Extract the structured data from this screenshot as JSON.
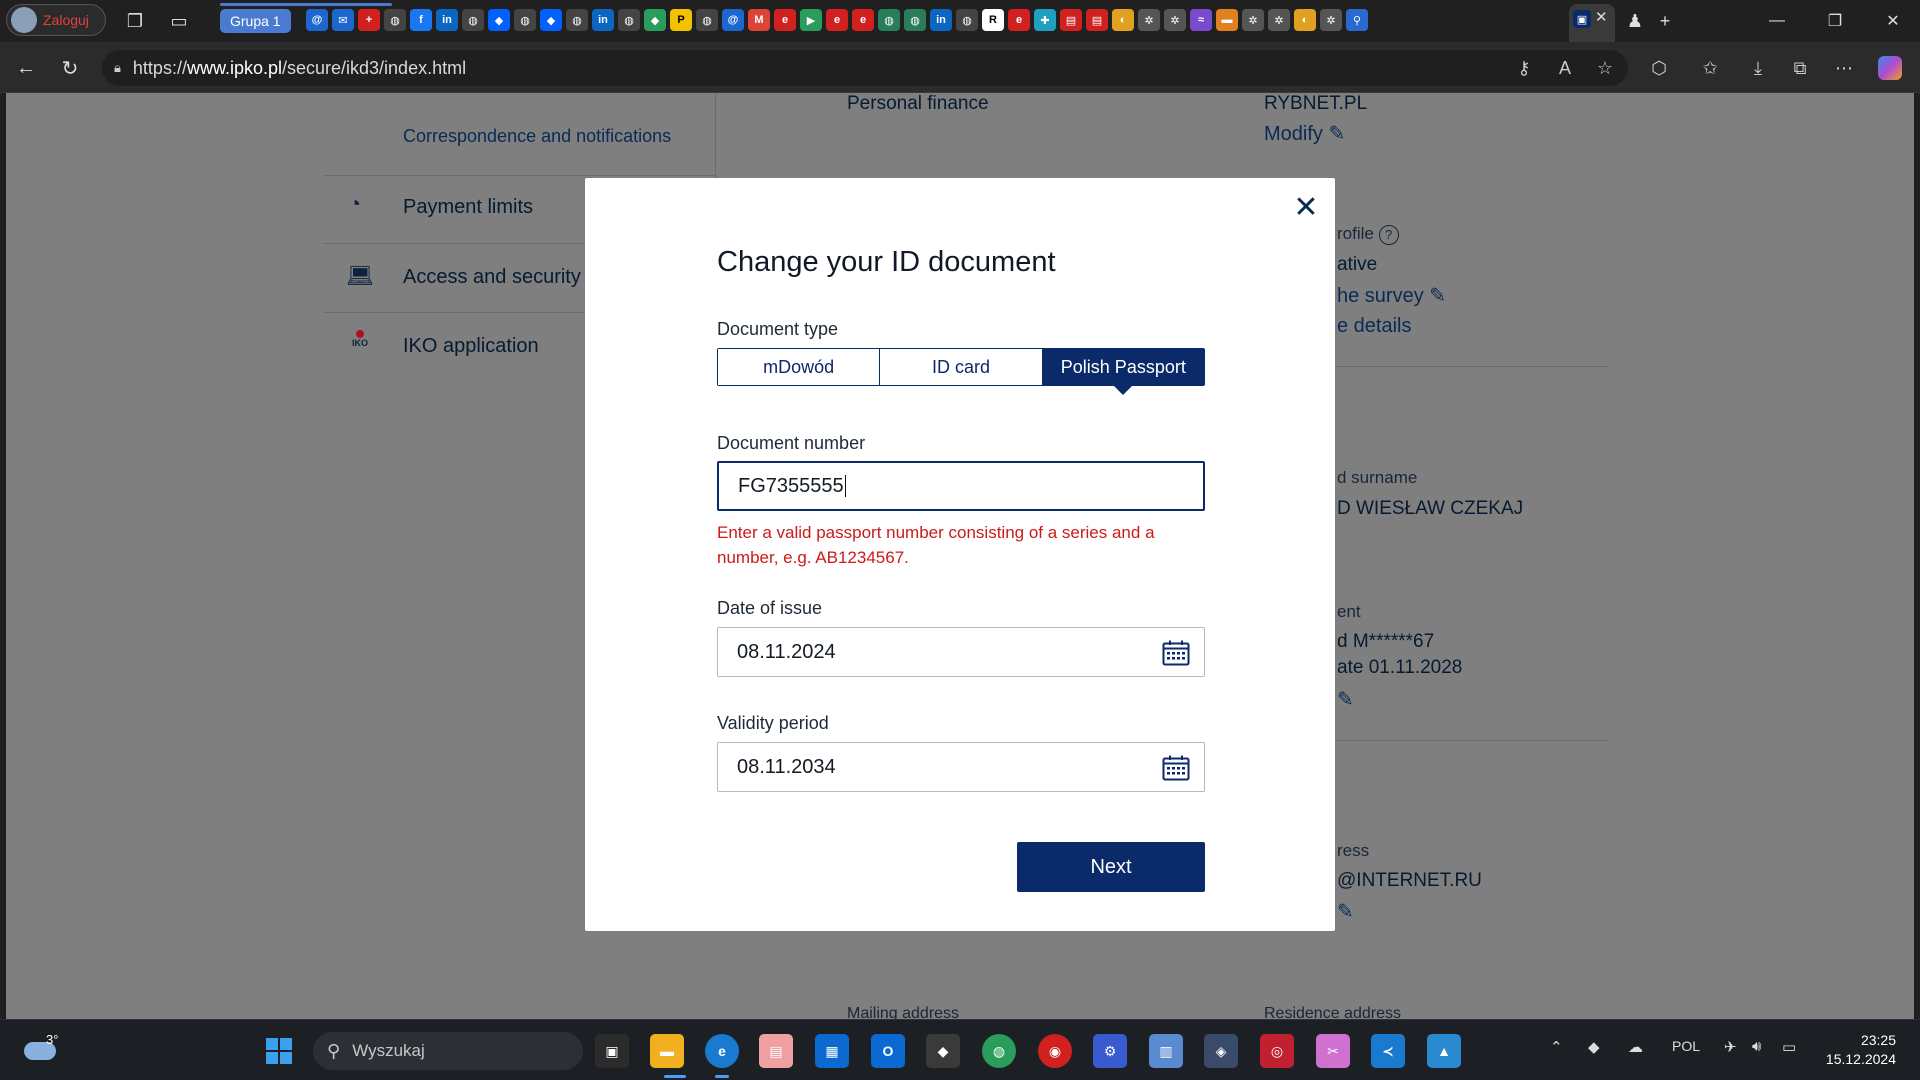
{
  "browser": {
    "profile_label": "Zaloguj",
    "tab_group_label": "Grupa 1",
    "url_prefix": "https://",
    "url_host": "www.ipko.pl",
    "url_path": "/secure/ikd3/index.html"
  },
  "background": {
    "sidebar": {
      "correspondence": "Correspondence and notifications",
      "items": [
        {
          "icon": "gauge-icon",
          "label": "Payment limits"
        },
        {
          "icon": "laptop-lock-icon",
          "label": "Access and security"
        },
        {
          "icon": "iko-icon",
          "label": "IKO application",
          "icon_text": "IKO"
        }
      ]
    },
    "personal_finance_label": "Personal finance",
    "rybnet": "RYBNET.PL",
    "modify": "Modify",
    "profile_partial": "rofile",
    "ative_partial": "ative",
    "survey_partial": "he survey",
    "details_partial": "e details",
    "surname_partial": "d surname",
    "name_partial": "D WIESŁAW CZEKAJ",
    "ent_partial": "ent",
    "doc_partial": "d M******67",
    "date_partial": "ate 01.11.2028",
    "ress_partial": "ress",
    "email_partial": "@INTERNET.RU",
    "mailing_partial": "Mailing address",
    "residence_partial": "Residence address"
  },
  "modal": {
    "title": "Change your ID document",
    "document_type_label": "Document type",
    "document_types": [
      "mDowód",
      "ID card",
      "Polish Passport"
    ],
    "selected_type": "Polish Passport",
    "document_number_label": "Document number",
    "document_number_value": "FG7355555",
    "error_message": "Enter a valid passport number consisting of a series and a number, e.g. AB1234567.",
    "date_of_issue_label": "Date of issue",
    "date_of_issue_value": "08.11.2024",
    "validity_period_label": "Validity period",
    "validity_period_value": "08.11.2034",
    "next_button": "Next"
  },
  "taskbar": {
    "temperature": "3°",
    "search_placeholder": "Wyszukaj",
    "language": "POL",
    "time": "23:25",
    "date": "15.12.2024"
  },
  "colors": {
    "brand_navy": "#0a2a6a",
    "error_red": "#cc1a1a",
    "overlay_gray": "#7f7f7f"
  }
}
